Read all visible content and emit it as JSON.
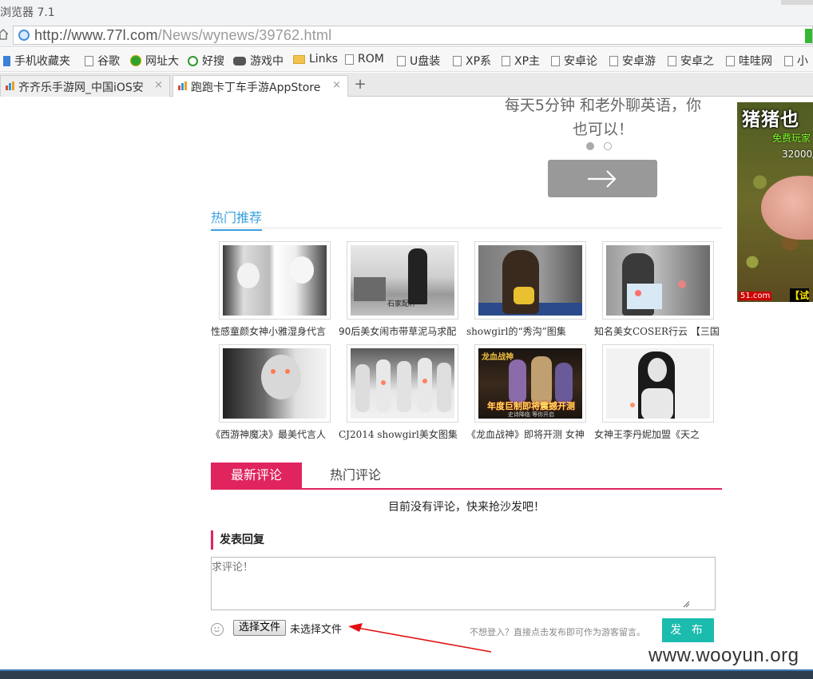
{
  "browser": {
    "title": "浏览器 7.1",
    "url_host": "http://www.77l.com",
    "url_path": "/News/wynews/39762.html",
    "bookmarks": [
      "手机收藏夹",
      "谷歌",
      "网址大",
      "好搜",
      "游戏中",
      "Links",
      "ROM",
      "U盘装",
      "XP系",
      "XP主",
      "安卓论",
      "安卓游",
      "安卓之",
      "哇哇网",
      "小"
    ],
    "tabs": [
      {
        "label": "齐齐乐手游网_中国iOS安",
        "close": "×"
      },
      {
        "label": "跑跑卡丁车手游AppStore",
        "close": "×"
      }
    ],
    "new_tab": "+"
  },
  "slide": {
    "text_line1": "每天5分钟 和老外聊英语，你",
    "text_line2": "也可以！"
  },
  "ad": {
    "title": "猪猪也",
    "sub": "免费玩家",
    "sub2": "32000/",
    "brand": "51.com",
    "brand2": "【试"
  },
  "hot": {
    "title": "热门推荐",
    "items": [
      {
        "caption": "性感童颜女神小雅湿身代言"
      },
      {
        "caption": "90后美女闹市带草泥马求配"
      },
      {
        "caption": "showgirl的“秀沟”图集"
      },
      {
        "caption": "知名美女COSER行云 【三国"
      },
      {
        "caption": "《西游神魔决》最美代言人"
      },
      {
        "caption": "CJ2014 showgirl美女图集"
      },
      {
        "caption": "《龙血战神》即将开测 女神"
      },
      {
        "caption": "女神王李丹妮加盟《天之"
      }
    ],
    "thumb_texts": {
      "t2": "石家配杯",
      "t7_top": "龙血战神",
      "t7_banner": "年度巨制即将震撼开测",
      "t7_sub": "史诗降临 等你开启"
    }
  },
  "comments": {
    "tab_latest": "最新评论",
    "tab_hot": "热门评论",
    "empty": "目前没有评论，快来抢沙发吧！",
    "reply_title": "发表回复",
    "placeholder": "求评论！",
    "file_button": "选择文件",
    "file_status": "未选择文件",
    "guest_hint": "不想登入？直接点击发布即可作为游客留言。",
    "publish": "发 布"
  },
  "watermark": "www.wooyun.org",
  "colors": {
    "accent_pink": "#e0245e",
    "accent_blue": "#3aa0e0",
    "publish_teal": "#1bbcae",
    "annotation_red": "#e01010"
  }
}
